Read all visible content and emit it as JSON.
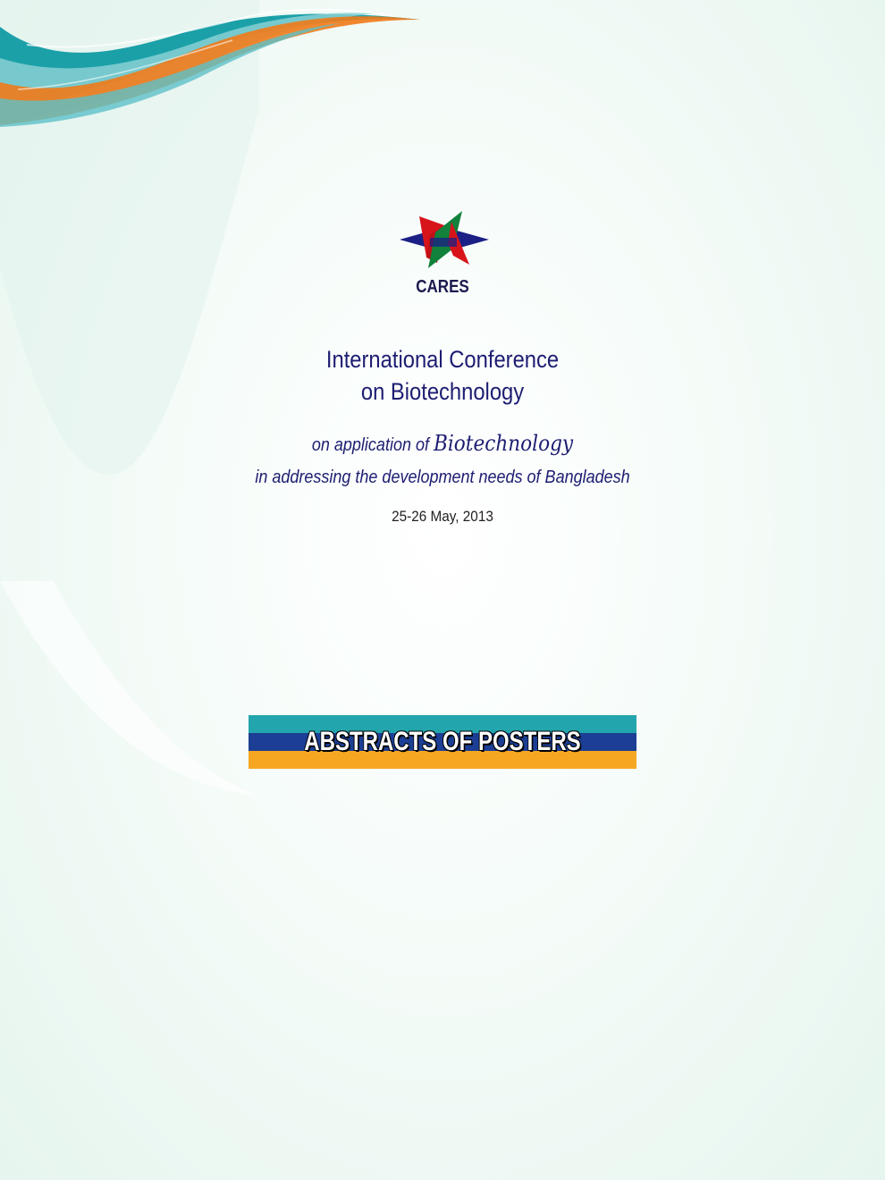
{
  "logo": {
    "name": "CARES",
    "colors": [
      "#d8141b",
      "#11813b",
      "#1b1f86"
    ]
  },
  "title": {
    "line1": "International Conference",
    "line2": "on Biotechnology"
  },
  "subtitle": {
    "prefix": "on application of ",
    "emphasis": "Biotechnology",
    "line2": "in addressing the development needs of Bangladesh"
  },
  "date": "25-26 May, 2013",
  "banner": {
    "text": "ABSTRACTS OF POSTERS",
    "colors": [
      "#23a5ad",
      "#1c3f95",
      "#f6a721"
    ]
  }
}
